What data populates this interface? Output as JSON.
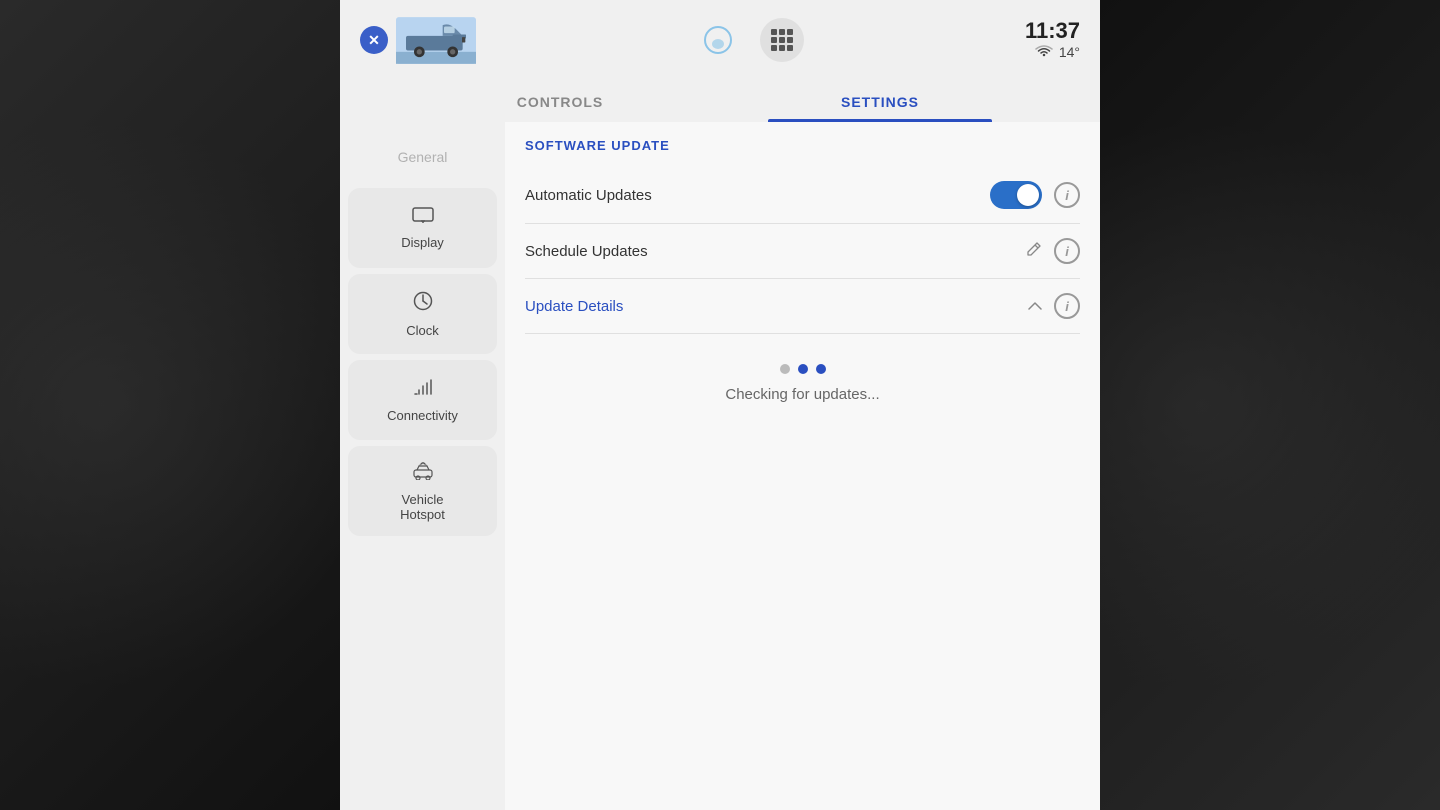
{
  "header": {
    "time": "11:37",
    "temperature": "14°",
    "close_label": "×"
  },
  "tabs": [
    {
      "id": "controls",
      "label": "CONTROLS",
      "active": false
    },
    {
      "id": "settings",
      "label": "SETTINGS",
      "active": true
    }
  ],
  "sidebar": {
    "items": [
      {
        "id": "general",
        "label": "General",
        "icon": ""
      },
      {
        "id": "display",
        "label": "Display",
        "icon": "▭"
      },
      {
        "id": "clock",
        "label": "Clock",
        "icon": "🕐"
      },
      {
        "id": "connectivity",
        "label": "Connectivity",
        "icon": "📶"
      },
      {
        "id": "vehicle-hotspot",
        "label": "Vehicle\nHotspot",
        "icon": "📡"
      }
    ]
  },
  "settings": {
    "section_title": "SOFTWARE UPDATE",
    "rows": [
      {
        "id": "automatic-updates",
        "label": "Automatic Updates",
        "has_toggle": true,
        "toggle_on": true,
        "has_info": true,
        "has_edit": false,
        "has_chevron": false
      },
      {
        "id": "schedule-updates",
        "label": "Schedule Updates",
        "has_toggle": false,
        "toggle_on": false,
        "has_info": true,
        "has_edit": true,
        "has_chevron": false
      },
      {
        "id": "update-details",
        "label": "Update Details",
        "label_blue": true,
        "has_toggle": false,
        "toggle_on": false,
        "has_info": true,
        "has_edit": false,
        "has_chevron": true
      }
    ],
    "loading": {
      "text": "Checking for updates...",
      "dots": [
        {
          "active": false
        },
        {
          "active": true
        },
        {
          "active": true
        }
      ]
    }
  },
  "icons": {
    "wifi": "📶",
    "display": "▭",
    "clock": "⏱",
    "connectivity": "📶",
    "hotspot": "📡"
  }
}
